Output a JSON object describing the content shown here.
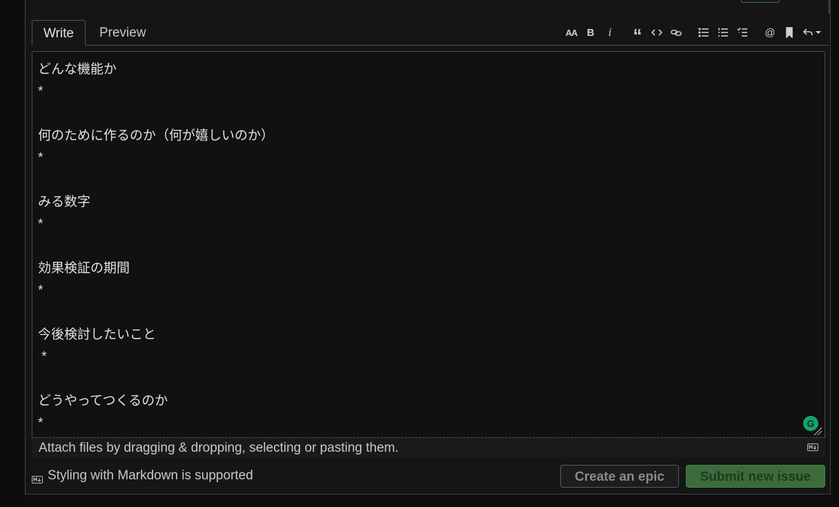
{
  "tabs": [
    {
      "label": "Write",
      "active": true
    },
    {
      "label": "Preview",
      "active": false
    }
  ],
  "toolbar": {
    "heading": "AA",
    "bold": "B",
    "italic": "i",
    "quote": "“",
    "mention": "@"
  },
  "editor": {
    "content": "どんな機能か\n*\n\n何のために作るのか（何が嬉しいのか）\n*\n\nみる数字\n*\n\n効果検証の期間\n*\n\n今後検討したいこと\n *\n\nどうやってつくるのか\n*"
  },
  "grammarly": {
    "letter": "G"
  },
  "attach": {
    "text": "Attach files by dragging & dropping, selecting or pasting them."
  },
  "footer": {
    "markdown_note": "Styling with Markdown is supported",
    "create_epic_label": "Create an epic",
    "submit_label": "Submit new issue"
  },
  "colors": {
    "accent_green": "#3c6b3c",
    "grammarly_green": "#15a46e",
    "background": "#0d0d0d"
  }
}
